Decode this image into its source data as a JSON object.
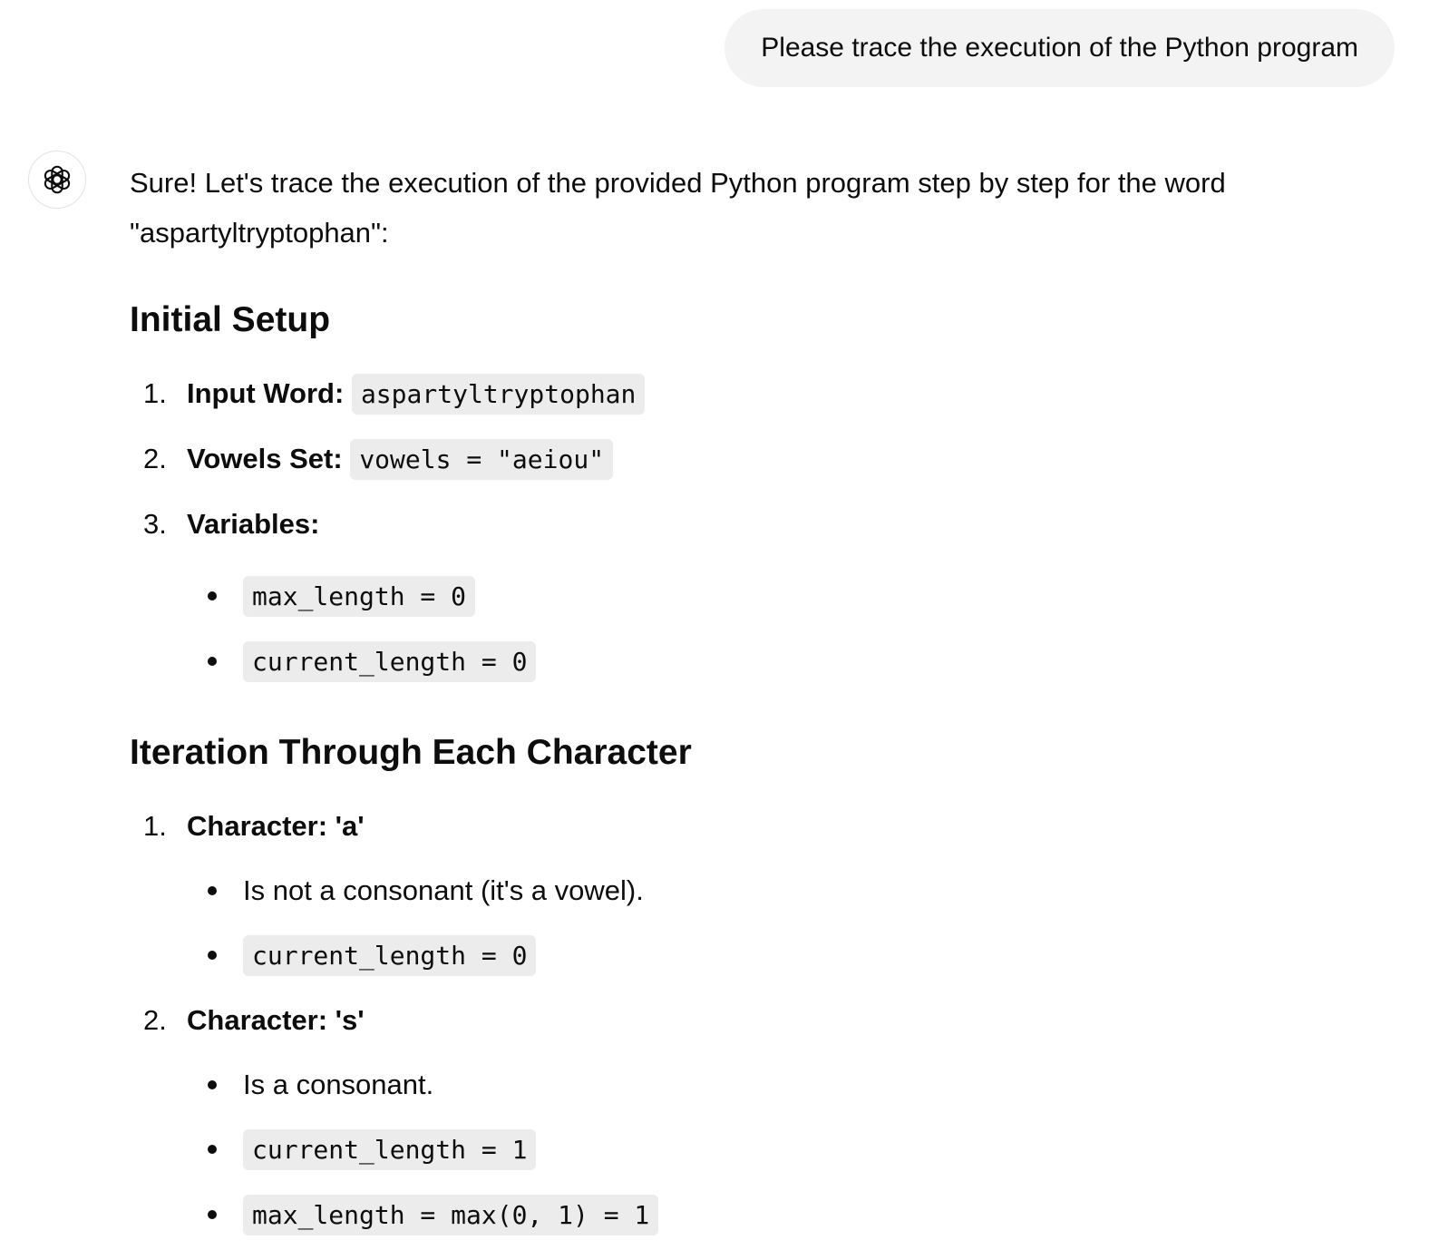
{
  "user_message": "Please trace the execution of the Python program",
  "assistant": {
    "intro": "Sure! Let's trace the execution of the provided Python program step by step for the word \"aspartyltryptophan\":",
    "setup": {
      "heading": "Initial Setup",
      "items": [
        {
          "num": "1.",
          "label": "Input Word:",
          "code": "aspartyltryptophan"
        },
        {
          "num": "2.",
          "label": "Vowels Set:",
          "code": "vowels = \"aeiou\""
        },
        {
          "num": "3.",
          "label": "Variables:",
          "bullets": [
            "max_length = 0",
            "current_length = 0"
          ]
        }
      ]
    },
    "iteration": {
      "heading": "Iteration Through Each Character",
      "items": [
        {
          "num": "1.",
          "label": "Character: 'a'",
          "note": "Is not a consonant (it's a vowel).",
          "codes": [
            "current_length = 0"
          ]
        },
        {
          "num": "2.",
          "label": "Character: 's'",
          "note": "Is a consonant.",
          "codes": [
            "current_length = 1",
            "max_length = max(0, 1) = 1"
          ]
        }
      ]
    }
  }
}
